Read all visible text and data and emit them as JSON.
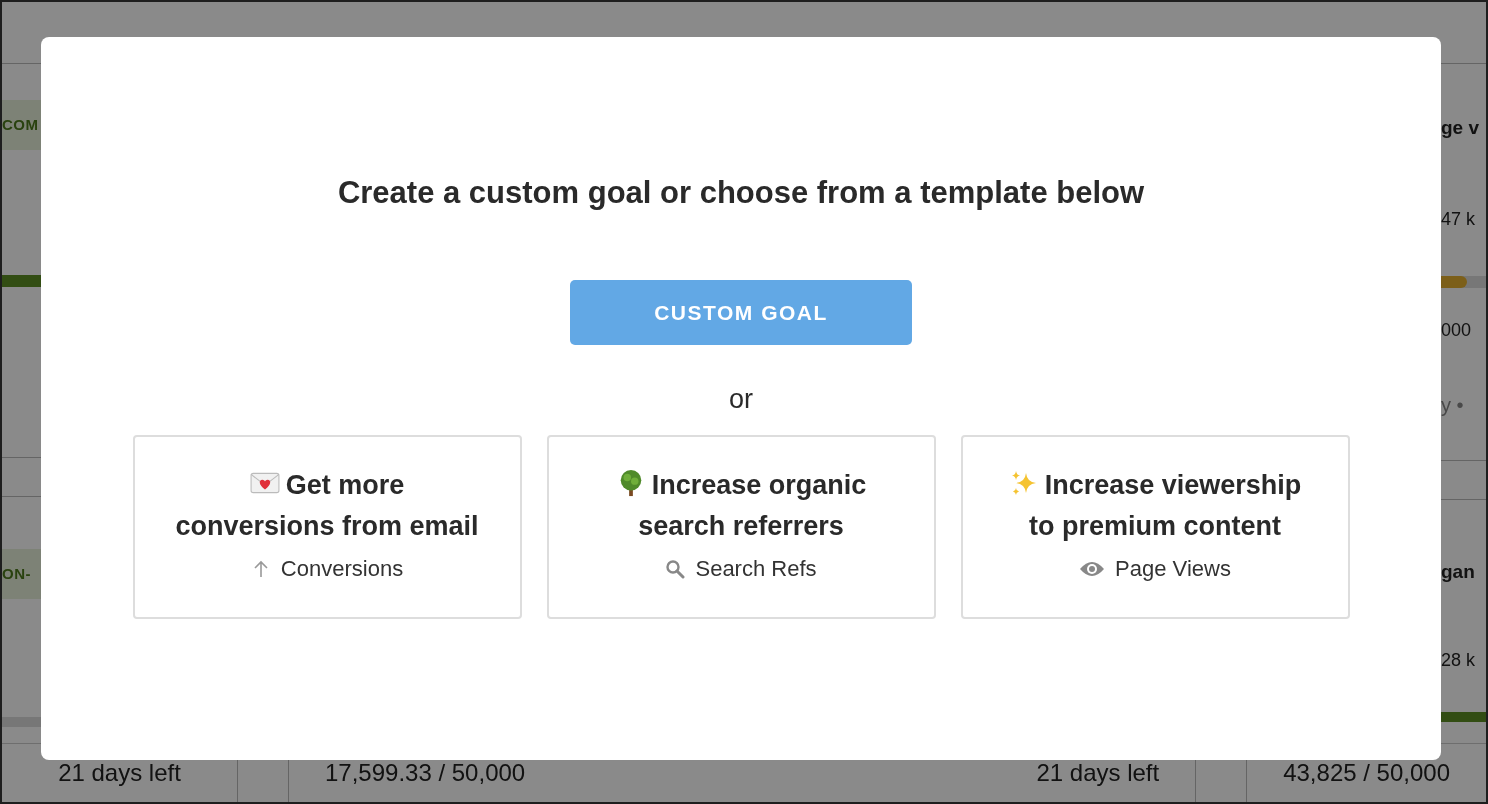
{
  "background": {
    "left": {
      "tag_1": "COM",
      "bar_1": {
        "level": 1
      },
      "tag_2": "ON-"
    },
    "right": {
      "heading_1": "ge v",
      "value_1": "47 k",
      "bar_1": {
        "level": 0.57
      },
      "target_1": "000",
      "note_1": "y •",
      "heading_2": "gan",
      "value_2": "28 k",
      "bar_2": {
        "level": 1
      }
    },
    "footer": {
      "left_days": "21 days left",
      "left_progress": "17,599.33 / 50,000",
      "right_days": "21 days left",
      "right_progress": "43,825 / 50,000"
    }
  },
  "dialog": {
    "title": "Create a custom goal or choose from a template below",
    "button": "CUSTOM GOAL",
    "separator": "or",
    "templates": [
      {
        "title_lines": [
          "Get more",
          "conversions from email"
        ],
        "metric": "Conversions"
      },
      {
        "title_lines": [
          "Increase organic",
          "search referrers"
        ],
        "metric": "Search Refs"
      },
      {
        "title_lines": [
          "Increase viewership",
          "to premium content"
        ],
        "metric": "Page Views"
      }
    ]
  }
}
